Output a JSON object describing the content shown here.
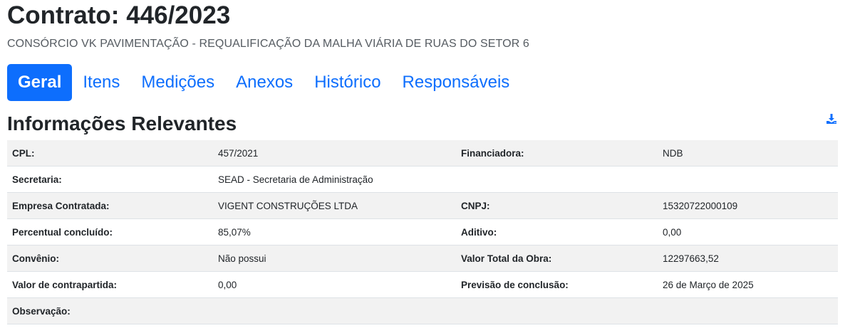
{
  "header": {
    "title": "Contrato: 446/2023",
    "subtitle": "CONSÓRCIO VK PAVIMENTAÇÃO - REQUALIFICAÇÃO DA MALHA VIÁRIA DE RUAS DO SETOR 6"
  },
  "tabs": [
    {
      "label": "Geral",
      "active": true
    },
    {
      "label": "Itens",
      "active": false
    },
    {
      "label": "Medições",
      "active": false
    },
    {
      "label": "Anexos",
      "active": false
    },
    {
      "label": "Histórico",
      "active": false
    },
    {
      "label": "Responsáveis",
      "active": false
    }
  ],
  "section": {
    "title": "Informações Relevantes",
    "download_icon": "download-icon"
  },
  "info": {
    "rows": [
      {
        "label1": "CPL:",
        "value1": "457/2021",
        "label2": "Financiadora:",
        "value2": "NDB"
      },
      {
        "label1": "Secretaria:",
        "value1": "SEAD - Secretaria de Administração",
        "label2": "",
        "value2": ""
      },
      {
        "label1": "Empresa Contratada:",
        "value1": "VIGENT CONSTRUÇÕES LTDA",
        "label2": "CNPJ:",
        "value2": "15320722000109"
      },
      {
        "label1": "Percentual concluído:",
        "value1": "85,07%",
        "label2": "Aditivo:",
        "value2": "0,00"
      },
      {
        "label1": "Convênio:",
        "value1": "Não possui",
        "label2": "Valor Total da Obra:",
        "value2": "12297663,52"
      },
      {
        "label1": "Valor de contrapartida:",
        "value1": "0,00",
        "label2": "Previsão de conclusão:",
        "value2": "26 de Março de 2025"
      },
      {
        "label1": "Observação:",
        "value1": "",
        "label2": "",
        "value2": ""
      }
    ]
  },
  "colors": {
    "accent": "#0d6efd",
    "stripe": "#f2f2f2",
    "text": "#212529"
  }
}
